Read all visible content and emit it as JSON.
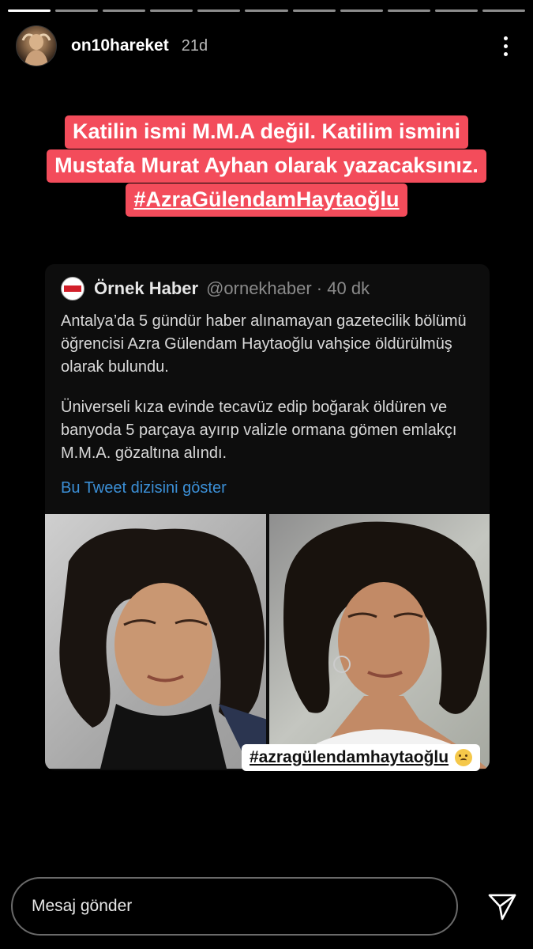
{
  "story": {
    "progress": {
      "segments": 11,
      "active_index": 0
    }
  },
  "header": {
    "username": "on10hareket",
    "time": "21d",
    "more_icon": "more-vertical-icon"
  },
  "caption": {
    "line1": "Katilin ismi M.M.A değil. Katilim ismini",
    "line2": "Mustafa Murat Ayhan olarak yazacaksınız.",
    "hashtag": "#AzraGülendamHaytaoğlu",
    "highlight_color": "#f34c5b"
  },
  "tweet": {
    "account_name": "Örnek Haber",
    "handle_time": "@ornekhaber · 40 dk",
    "paragraph1": "Antalya’da 5 gündür haber alınamayan gazetecilik bölümü öğrencisi Azra Gülendam Haytaoğlu vahşice öldürülmüş olarak bulundu.",
    "paragraph2": "Üniverseli kıza evinde tecavüz edip boğarak öldüren ve banyoda 5 parçaya ayırıp valizle ormana gömen emlakçı M.M.A. gözaltına alındı.",
    "link_label": "Bu Tweet dizisini göster",
    "link_color": "#3b8fd6"
  },
  "sticker": {
    "hashtag": "#azragülendamhaytaoğlu",
    "emoji": "crying-face-icon"
  },
  "footer": {
    "reply_placeholder": "Mesaj gönder",
    "send_icon": "send-icon"
  }
}
